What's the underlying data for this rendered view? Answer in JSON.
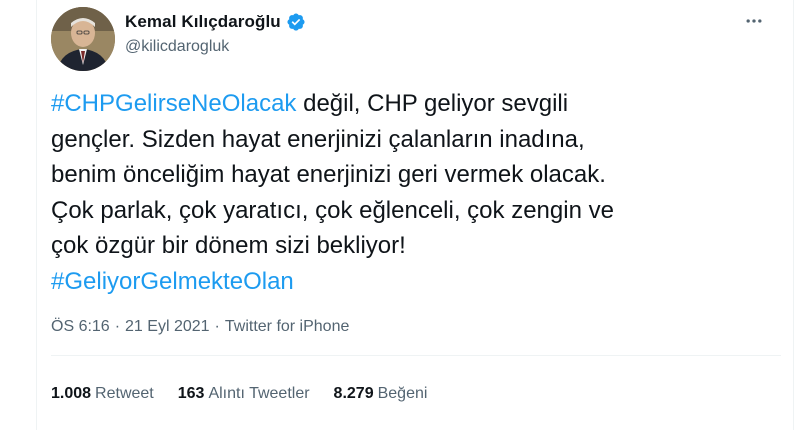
{
  "author": {
    "display_name": "Kemal Kılıçdaroğlu",
    "handle": "@kilicdarogluk",
    "verified": true
  },
  "tweet": {
    "segments": [
      {
        "text": "#CHPGelirseNeOlacak",
        "hashtag": true
      },
      {
        "text": " değil, CHP geliyor sevgili\ngençler. Sizden hayat enerjinizi çalanların inadına,\nbenim önceliğim hayat enerjinizi geri vermek olacak.\nÇok parlak, çok yaratıcı, çok eğlenceli, çok zengin ve\nçok özgür bir dönem sizi bekliyor!\n",
        "hashtag": false
      },
      {
        "text": "#GeliyorGelmekteOlan",
        "hashtag": true
      }
    ]
  },
  "meta": {
    "time": "ÖS 6:16",
    "separator": "·",
    "date": "21 Eyl 2021",
    "source": "Twitter for iPhone"
  },
  "stats": {
    "retweets_count": "1.008",
    "retweets_label": "Retweet",
    "quotes_count": "163",
    "quotes_label": "Alıntı Tweetler",
    "likes_count": "8.279",
    "likes_label": "Beğeni"
  },
  "icons": {
    "verified": "verified-badge-icon",
    "more": "more-options-icon"
  },
  "colors": {
    "link": "#1d9bf0",
    "text": "#0f1419",
    "secondary": "#536471",
    "divider": "#eff3f4"
  }
}
